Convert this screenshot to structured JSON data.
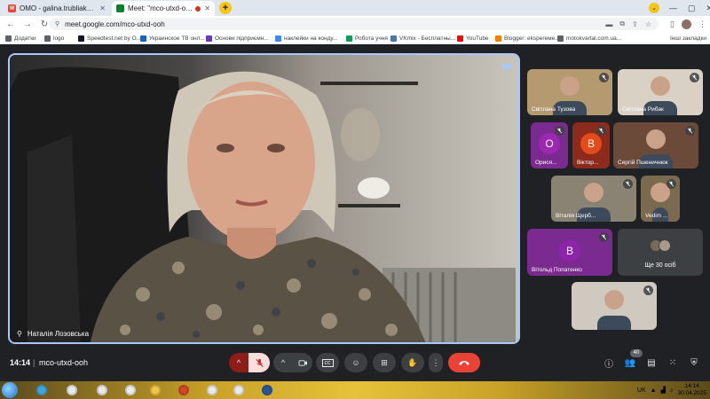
{
  "browser": {
    "tabs": [
      {
        "label": "ОМО - galina.trubliak@gmail.co",
        "favicon": "gmail-icon",
        "color": "#ea4335",
        "glyph": "M",
        "active": false
      },
      {
        "label": "Meet: \"mco-utxd-ooh\"",
        "favicon": "meet-icon",
        "color": "#00832d",
        "glyph": "",
        "active": true
      }
    ],
    "new_tab_glyph": "+",
    "url": "meet.google.com/mco-utxd-ooh",
    "bookmarks": [
      {
        "label": "Додатки",
        "icon": "apps-grid-icon",
        "color": "#5f6368"
      },
      {
        "label": "logo",
        "icon": "globe-icon",
        "color": "#5f6368"
      },
      {
        "label": "Speedtest.net by O...",
        "icon": "speedtest-icon",
        "color": "#141526"
      },
      {
        "label": "Украинское ТВ онл...",
        "icon": "tv-icon",
        "color": "#1565c0"
      },
      {
        "label": "Основи підприємн...",
        "icon": "bookmark-icon",
        "color": "#673ab7"
      },
      {
        "label": "наклейки на конду...",
        "icon": "google-icon",
        "color": "#4285f4"
      },
      {
        "label": "Робота учня",
        "icon": "bookmark-icon",
        "color": "#0f9d58"
      },
      {
        "label": "VKmix - Бесплатны...",
        "icon": "vk-icon",
        "color": "#4a76a8"
      },
      {
        "label": "YouTube",
        "icon": "youtube-icon",
        "color": "#ff0000"
      },
      {
        "label": "Blogger: eksperеме...",
        "icon": "blogger-icon",
        "color": "#f57c00"
      },
      {
        "label": "motokvartal.com.ua...",
        "icon": "globe-icon",
        "color": "#5f6368"
      }
    ],
    "bookmarks_other": "Інші закладки"
  },
  "meet": {
    "main_speaker": "Наталія Лозовська",
    "time": "14:14",
    "code": "mco-utxd-ooh",
    "participant_count": "40",
    "tiles": [
      {
        "name": "Світлана Тузова",
        "kind": "video",
        "bg": "#b59a70"
      },
      {
        "name": "Світлана Рибак",
        "kind": "video",
        "bg": "#d9d2c4"
      },
      {
        "name": "Орися...",
        "kind": "avatar",
        "bg": "#7b2a90",
        "avatar_bg": "#9c27b0",
        "letter": "О"
      },
      {
        "name": "Віктор...",
        "kind": "avatar",
        "bg": "#8c2a1e",
        "avatar_bg": "#e64a19",
        "letter": "В"
      },
      {
        "name": "Сергій Пшеничнюк",
        "kind": "video",
        "bg": "#6b4a3a"
      },
      {
        "name": "Віталія Щерб...",
        "kind": "video",
        "bg": "#8a8272"
      },
      {
        "name": "Vedim ...",
        "kind": "video",
        "bg": "#7a6a50"
      },
      {
        "name": "Вітольд Попатенко",
        "kind": "avatar",
        "bg": "#7b2a90",
        "avatar_bg": "#8e24aa",
        "letter": "В"
      },
      {
        "name": "Ще 30 осіб",
        "kind": "more",
        "bg": "#3c4043"
      },
      {
        "name": "",
        "kind": "video",
        "bg": "#cfc9c0"
      }
    ]
  },
  "taskbar": {
    "lang": "UK",
    "clock_time": "14:14",
    "clock_date": "30.04.2025",
    "apps": [
      {
        "icon": "weather-icon",
        "color": "#3da5e0"
      },
      {
        "icon": "chrome-icon",
        "color": "#e8eaed"
      },
      {
        "icon": "yandex-browser-icon",
        "color": "#e8eaed"
      },
      {
        "icon": "chrome-icon",
        "color": "#e8eaed"
      },
      {
        "icon": "file-explorer-icon",
        "color": "#f3c548"
      },
      {
        "icon": "powerpoint-icon",
        "color": "#d24726"
      },
      {
        "icon": "chrome-icon",
        "color": "#e8eaed"
      },
      {
        "icon": "chrome-icon",
        "color": "#e8eaed"
      },
      {
        "icon": "word-icon",
        "color": "#2b579a"
      }
    ]
  },
  "colors": {
    "meet_bg": "#202124",
    "accent_border": "#a8c7fa",
    "end_call": "#ea4335",
    "control_bg": "#3c4043"
  }
}
